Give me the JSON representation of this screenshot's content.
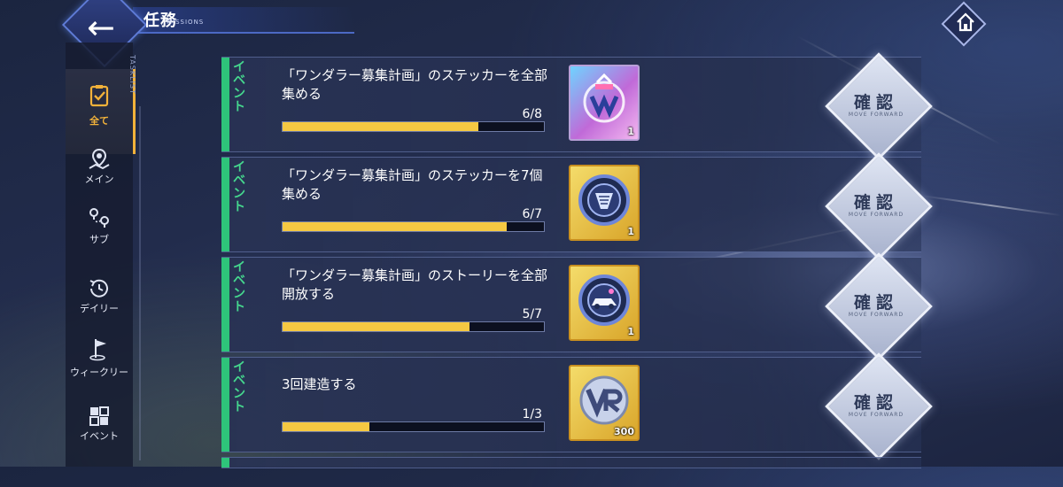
{
  "header": {
    "title": "任務",
    "subtitle": "MISSIONS"
  },
  "sidebar": {
    "tasklist_label": "TASKLIST",
    "items": [
      {
        "label": "全て",
        "icon": "checklist-icon",
        "active": true
      },
      {
        "label": "メイン",
        "icon": "map-pin-icon",
        "active": false
      },
      {
        "label": "サブ",
        "icon": "route-pins-icon",
        "active": false
      },
      {
        "label": "デイリー",
        "icon": "clock-icon",
        "active": false
      },
      {
        "label": "ウィークリー",
        "icon": "flag-icon",
        "active": false
      },
      {
        "label": "イベント",
        "icon": "event-grid-icon",
        "active": false
      }
    ]
  },
  "missions": [
    {
      "category": "イベント",
      "description": "「ワンダラー募集計画」のステッカーを全部集める",
      "progress_text": "6/8",
      "progress": 0.75,
      "reward_count": "1",
      "reward_icon": "sticker-emblem-icon",
      "confirm_label": "確認",
      "confirm_sub": "MOVE FORWARD"
    },
    {
      "category": "イベント",
      "description": "「ワンダラー募集計画」のステッカーを7個集める",
      "progress_text": "6/7",
      "progress": 0.857,
      "reward_count": "1",
      "reward_icon": "gear-badge-icon",
      "confirm_label": "確認",
      "confirm_sub": "MOVE FORWARD"
    },
    {
      "category": "イベント",
      "description": "「ワンダラー募集計画」のストーリーを全部開放する",
      "progress_text": "5/7",
      "progress": 0.714,
      "reward_count": "1",
      "reward_icon": "car-badge-icon",
      "confirm_label": "確認",
      "confirm_sub": "MOVE FORWARD"
    },
    {
      "category": "イベント",
      "description": "3回建造する",
      "progress_text": "1/3",
      "progress": 0.333,
      "reward_count": "300",
      "reward_icon": "vr-coin-icon",
      "confirm_label": "確認",
      "confirm_sub": "MOVE FORWARD"
    }
  ]
}
